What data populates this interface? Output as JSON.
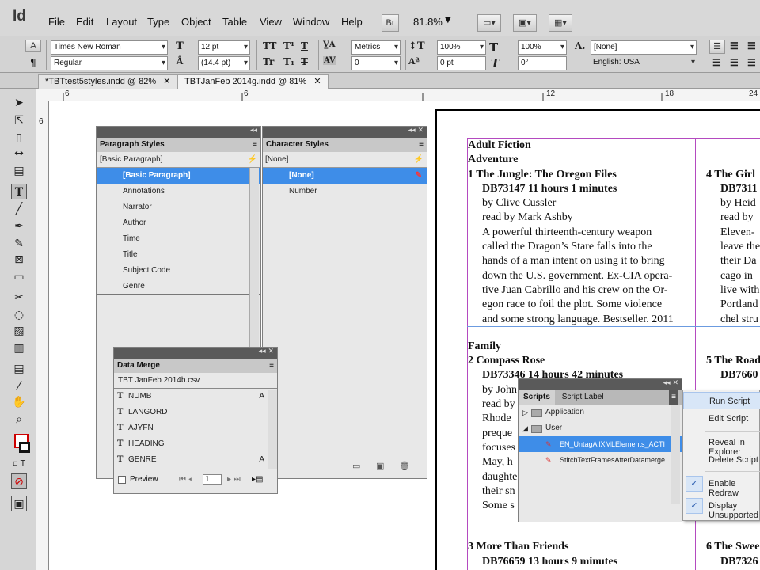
{
  "app": {
    "logo": "Id",
    "menu": [
      "File",
      "Edit",
      "Layout",
      "Type",
      "Object",
      "Table",
      "View",
      "Window",
      "Help"
    ],
    "bridge": "Br",
    "zoom": "81.8%"
  },
  "control": {
    "font_family": "Times New Roman",
    "font_style": "Regular",
    "font_size": "12 pt",
    "leading": "(14.4 pt)",
    "kerning": "Metrics",
    "tracking": "0",
    "vscale": "100%",
    "hscale": "100%",
    "baseline": "0 pt",
    "skew": "0°",
    "char_style": "[None]",
    "language": "English: USA"
  },
  "tabs": [
    {
      "label": "*TBTtest5styles.indd @ 82%"
    },
    {
      "label": "TBTJanFeb 2014g.indd @ 81%"
    }
  ],
  "ruler": {
    "h": [
      "6",
      "6",
      "12",
      "18",
      "24"
    ],
    "v": [
      "6"
    ]
  },
  "paragraph_styles": {
    "title": "Paragraph Styles",
    "current": "[Basic Paragraph]",
    "items": [
      "[Basic Paragraph]",
      "Annotations",
      "Narrator",
      "Author",
      "Time",
      "Title",
      "Subject Code",
      "Genre"
    ]
  },
  "character_styles": {
    "title": "Character Styles",
    "current": "[None]",
    "items": [
      "[None]",
      "Number"
    ]
  },
  "data_merge": {
    "title": "Data Merge",
    "source": "TBT JanFeb 2014b.csv",
    "fields": [
      "NUMB",
      "LANGORD",
      "AJYFN",
      "HEADING",
      "GENRE"
    ],
    "preview_label": "Preview",
    "page": "1"
  },
  "scripts": {
    "tab1": "Scripts",
    "tab2": "Script Label",
    "tree": [
      "Application",
      "User",
      "EN_UntagAllXMLElements_ACTI",
      "StitchTextFramesAfterDatamerge"
    ]
  },
  "context_menu": {
    "items": [
      "Run Script",
      "Edit Script",
      "Reveal in Explorer",
      "Delete Script",
      "Enable Redraw",
      "Display Unsupported"
    ]
  },
  "document": {
    "col1": [
      "Adult Fiction",
      "Adventure",
      "1 The Jungle: The Oregon Files",
      "DB73147 11 hours 1 minutes",
      "by Clive Cussler",
      "read by Mark Ashby",
      "A powerful thirteenth-century weapon",
      "called the Dragon’s Stare falls into the",
      "hands of a man intent on using it to bring",
      "down the U.S. government. Ex-CIA opera-",
      "tive Juan Cabrillo and his crew on the Or-",
      "egon race to foil the plot. Some violence",
      "and some strong language. Bestseller. 2011",
      "Family",
      "2 Compass Rose",
      "DB73346 14 hours 42 minutes",
      "by John",
      "read by",
      "Rhode",
      "preque",
      "focuses",
      "May, h",
      "daughte",
      "their sn",
      "Some s",
      "3 More Than Friends",
      "DB76659 13 hours 9 minutes"
    ],
    "col2": [
      "4 The Girl",
      "DB7311",
      "by Heid",
      "read by",
      "Eleven-",
      "leave the",
      "their Da",
      "cago in",
      "live with",
      "Portland",
      "chel stru",
      "5 The Road",
      "DB7660",
      "6 The Swee",
      "DB7326"
    ]
  }
}
